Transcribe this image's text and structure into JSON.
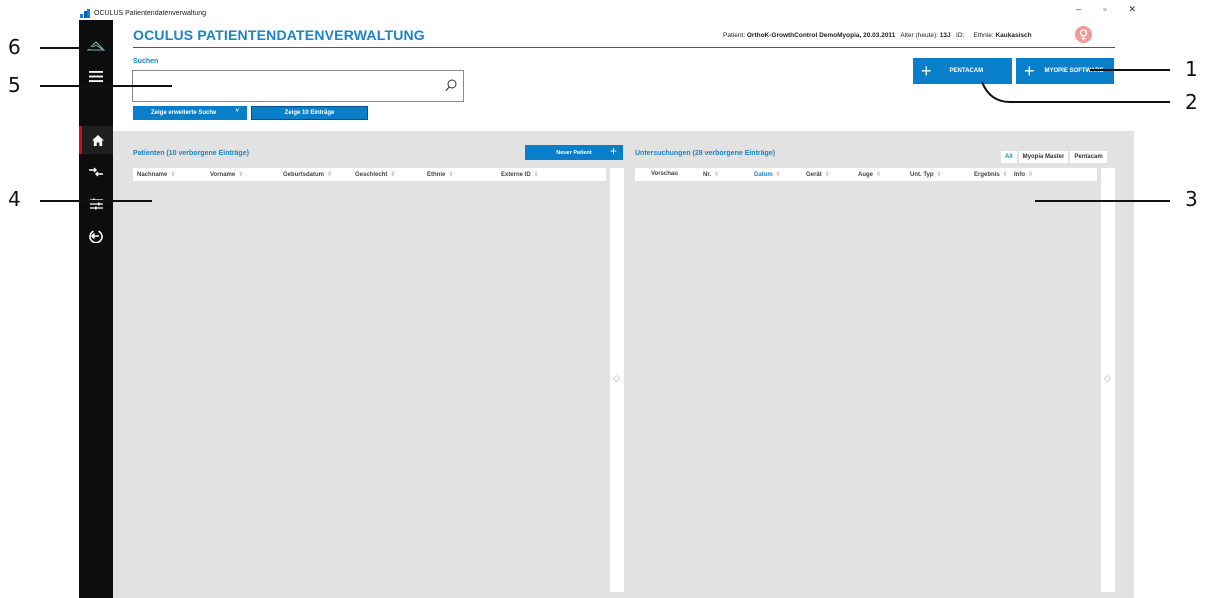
{
  "window": {
    "title": "OCULUS Patientendatenverwaltung",
    "controls": [
      "–",
      "▫",
      "✕"
    ]
  },
  "header": {
    "app_title": "OCULUS PATIENTENDATENVERWALTUNG",
    "patient_label": "Patient:",
    "patient_value": "OrthoK-GrowthControl DemoMyopia, 20.03.2011",
    "age_label": "Alter (heute):",
    "age_value": "13J",
    "id_label": "ID:",
    "ethnicity_label": "Ethnie:",
    "ethnicity_value": "Kaukasisch"
  },
  "sidebar": {
    "items": [
      "logo",
      "menu",
      "home",
      "swap",
      "settings",
      "logout"
    ],
    "active": "home"
  },
  "search": {
    "label": "Suchen",
    "value": "",
    "advanced_button": "Zeige erweiterte Suche",
    "advanced_chevron": "˅",
    "show_entries_button": "Zeige 10 Einträge"
  },
  "actions": {
    "pentacam": "PENTACAM",
    "myopie": "MYOPIE SOFTWARE",
    "plus": "+"
  },
  "patients": {
    "title": "Patienten (10 verborgene Einträge)",
    "new_button": "Neuer Patient",
    "columns": [
      "Nachname",
      "Vorname",
      "Geburtsdatum",
      "Geschlecht",
      "Ethnie",
      "Externe ID"
    ]
  },
  "exams": {
    "title": "Untersuchungen (28 verborgene Einträge)",
    "tabs": [
      "All",
      "Myopia Master",
      "Pentacam"
    ],
    "active_tab": "All",
    "columns": [
      "Vorschau",
      "Nr.",
      "Datum",
      "Gerät",
      "Auge",
      "Unt. Typ",
      "Ergebnis",
      "Info"
    ]
  },
  "sort_glyph": "⇳",
  "scroll_glyph": "◇",
  "callouts": [
    "1",
    "2",
    "3",
    "4",
    "5",
    "6"
  ],
  "colors": {
    "accent": "#1b83c6",
    "button": "#0a7fc9",
    "sidebar": "#0d0d0d",
    "active_marker": "#d0101f",
    "workarea": "#e2e2e2",
    "avatar": "#f29a97"
  }
}
